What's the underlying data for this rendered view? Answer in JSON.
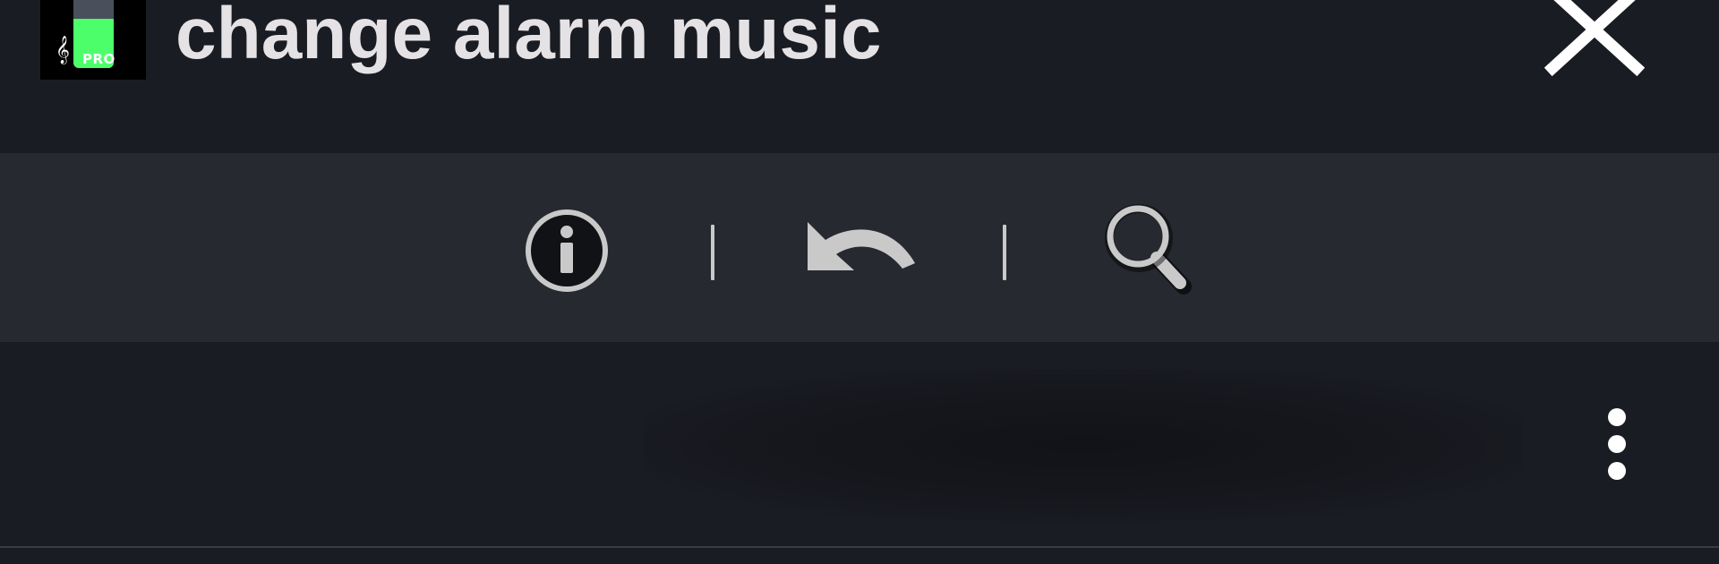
{
  "header": {
    "title": "change alarm music",
    "app_icon": {
      "badge": "PRO",
      "clef_glyph": "𝄞",
      "level_percent": 72,
      "icon": "volume-meter-icon"
    },
    "close_icon": "close-icon"
  },
  "toolbar": {
    "items": [
      {
        "name": "info",
        "icon": "info-icon"
      },
      {
        "name": "undo",
        "icon": "undo-icon"
      },
      {
        "name": "search",
        "icon": "search-icon"
      }
    ]
  },
  "content": {
    "more_icon": "more-vertical-icon"
  },
  "colors": {
    "background": "#1a1c23",
    "toolbar": "#262930",
    "title_text": "#e4e2e4",
    "accent_green": "#4cff6a",
    "icon_gray": "#c9c9c9"
  }
}
